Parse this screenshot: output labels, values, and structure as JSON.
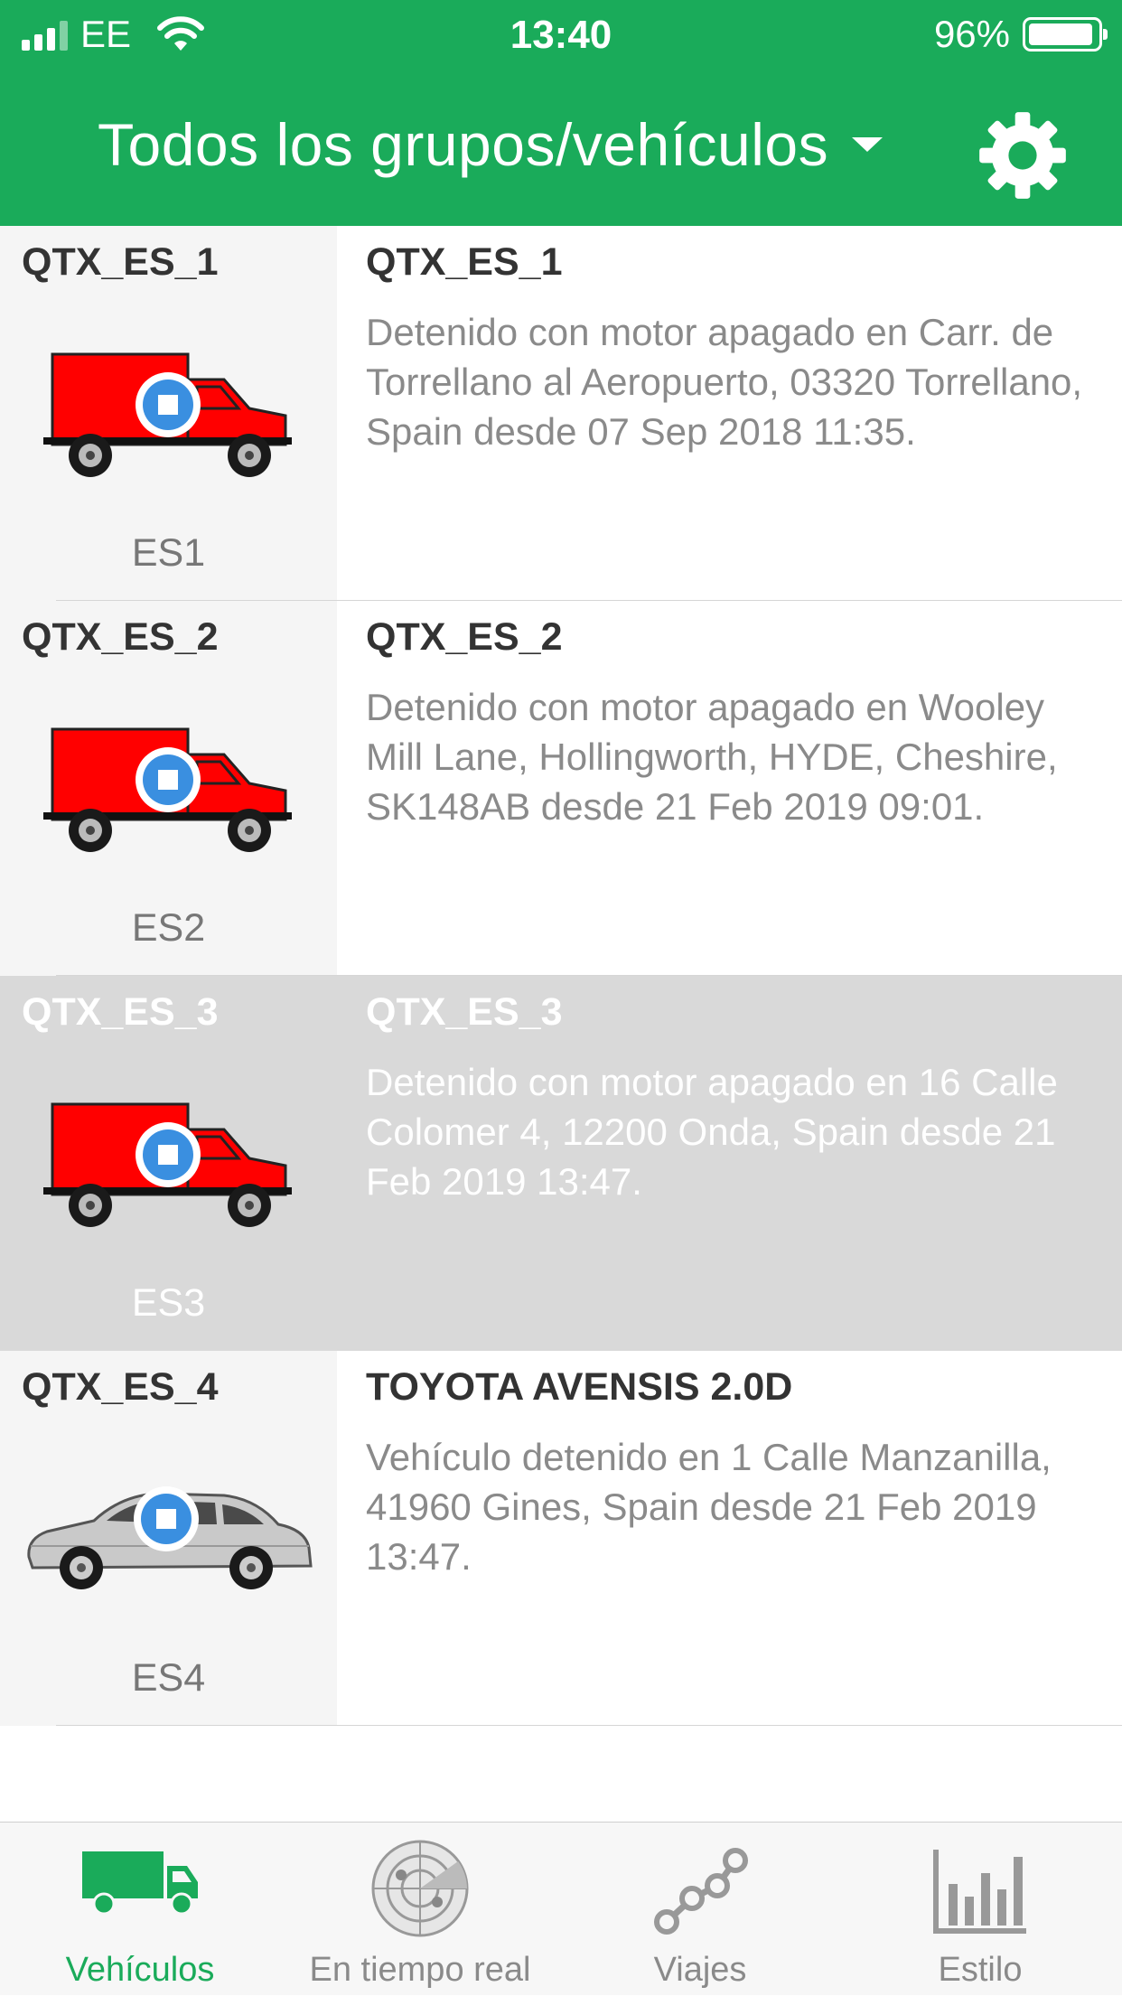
{
  "status_bar": {
    "carrier": "EE",
    "time": "13:40",
    "battery": "96%"
  },
  "nav": {
    "title": "Todos los grupos/vehículos"
  },
  "colors": {
    "accent": "#1aab5a",
    "vehicle_red": "#ff0000",
    "status_blue": "#3a8fe0"
  },
  "vehicles": [
    {
      "id": "QTX_ES_1",
      "short": "ES1",
      "name": "QTX_ES_1",
      "icon": "red-truck-icon",
      "description": "Detenido con motor apagado en Carr. de Torrellano al Aeropuerto, 03320 Torrellano, Spain desde 07 Sep 2018 11:35."
    },
    {
      "id": "QTX_ES_2",
      "short": "ES2",
      "name": "QTX_ES_2",
      "icon": "red-truck-icon",
      "description": "Detenido con motor apagado en Wooley Mill Lane, Hollingworth, HYDE, Cheshire, SK148AB desde 21 Feb 2019 09:01."
    },
    {
      "id": "QTX_ES_3",
      "short": "ES3",
      "name": "QTX_ES_3",
      "icon": "red-truck-icon",
      "description": "Detenido con motor apagado en 16 Calle Colomer 4, 12200 Onda, Spain desde 21 Feb 2019 13:47."
    },
    {
      "id": "QTX_ES_4",
      "short": "ES4",
      "name": "TOYOTA AVENSIS 2.0D",
      "icon": "silver-car-icon",
      "description": "Vehículo detenido en 1 Calle Manzanilla, 41960 Gines, Spain desde 21 Feb 2019 13:47."
    }
  ],
  "tabs": [
    {
      "label": "Vehículos",
      "icon": "truck-icon",
      "active": true
    },
    {
      "label": "En tiempo real",
      "icon": "radar-icon",
      "active": false
    },
    {
      "label": "Viajes",
      "icon": "route-icon",
      "active": false
    },
    {
      "label": "Estilo",
      "icon": "bar-chart-icon",
      "active": false
    }
  ]
}
